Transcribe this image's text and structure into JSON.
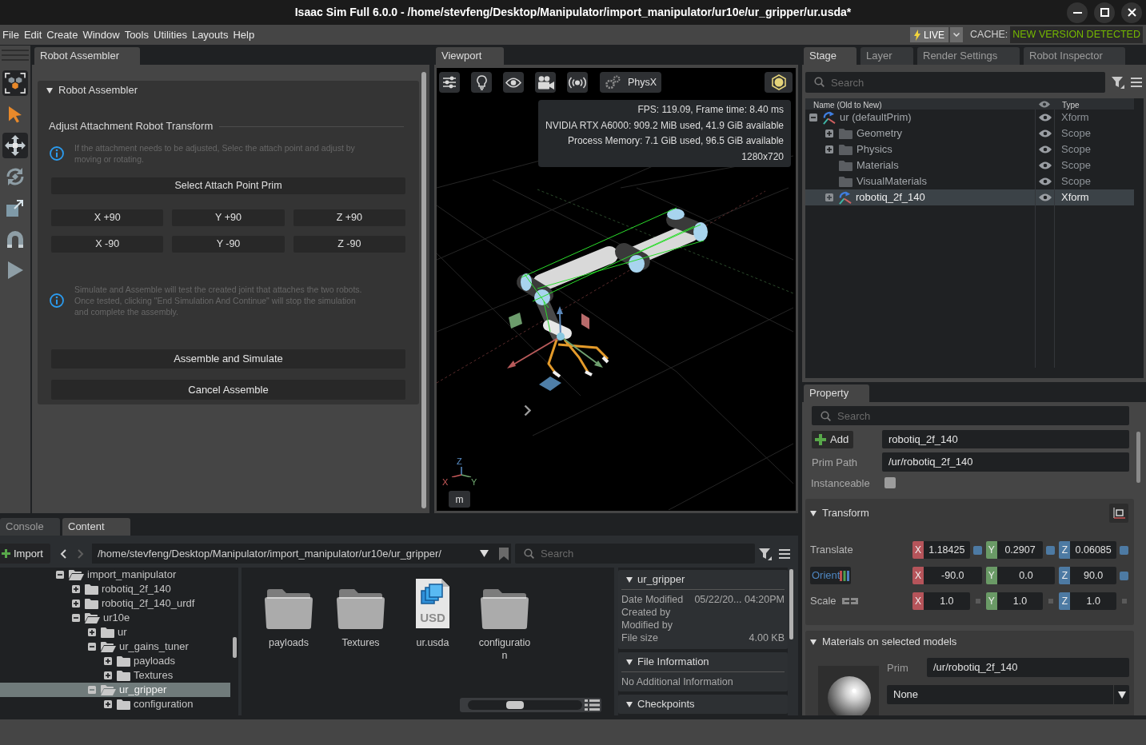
{
  "window": {
    "title": "Isaac Sim Full 6.0.0 - /home/stevfeng/Desktop/Manipulator/import_manipulator/ur10e/ur_gripper/ur.usda*"
  },
  "menu": [
    "File",
    "Edit",
    "Create",
    "Window",
    "Tools",
    "Utilities",
    "Layouts",
    "Help"
  ],
  "live": {
    "label": "LIVE"
  },
  "cache": {
    "label": "CACHE:",
    "status": "NEW VERSION DETECTED"
  },
  "toolbar": [
    {
      "selected": true
    },
    {
      "selected": false
    },
    {
      "selected": true
    },
    {
      "selected": false
    },
    {
      "selected": false
    },
    {
      "selected": false
    },
    {
      "selected": false
    }
  ],
  "robot_assembler": {
    "tab": {
      "label": "Robot Assembler",
      "selected": true
    },
    "frame": {
      "title": "Robot Assembler",
      "expanded": true
    },
    "adjust_heading": "Adjust Attachment Robot Transform",
    "adjust_note": "If the attachment needs to be adjusted, Selec the attach point and adjust by moving or rotating.",
    "select_button": "Select Attach Point Prim",
    "rotate_buttons": [
      "X +90",
      "Y +90",
      "Z +90",
      "X -90",
      "Y -90",
      "Z -90"
    ],
    "simulate_note": "Simulate and Assemble will test the created joint that attaches the two robots. Once tested, clicking \"End Simulation And Continue\" will stop the simulation and complete the assembly.",
    "action_buttons": [
      "Assemble and Simulate",
      "Cancel Assemble"
    ]
  },
  "viewport": {
    "tab": {
      "label": "Viewport",
      "selected": true
    },
    "physx_button": "PhysX",
    "stats": [
      "FPS: 119.09, Frame time: 8.40 ms",
      "NVIDIA RTX A6000: 909.2 MiB used, 41.9 GiB available",
      "Process Memory: 7.1 GiB used, 96.5 GiB available",
      "1280x720"
    ],
    "axis_labels": {
      "x": "X",
      "y": "Y",
      "z": "Z"
    },
    "unit_button": "m"
  },
  "stage": {
    "tabs": [
      {
        "label": "Stage",
        "selected": true
      },
      {
        "label": "Layer",
        "selected": false
      },
      {
        "label": "Render Settings",
        "selected": false
      },
      {
        "label": "Robot Inspector",
        "selected": false
      }
    ],
    "search": {
      "placeholder": "Search"
    },
    "columns": {
      "name": "Name (Old to New)",
      "type": "Type"
    },
    "tree": [
      {
        "name": "ur (defaultPrim)",
        "type": "Xform",
        "kind": "xform",
        "expanded": true,
        "selected": false,
        "visible": true,
        "children": [
          {
            "name": "Geometry",
            "type": "Scope",
            "kind": "scope",
            "expanded": false,
            "selected": false,
            "visible": true
          },
          {
            "name": "Physics",
            "type": "Scope",
            "kind": "scope",
            "expanded": false,
            "selected": false,
            "visible": true
          },
          {
            "name": "Materials",
            "type": "Scope",
            "kind": "scope",
            "selected": false,
            "visible": true
          },
          {
            "name": "VisualMaterials",
            "type": "Scope",
            "kind": "scope",
            "selected": false,
            "visible": true
          },
          {
            "name": "robotiq_2f_140",
            "type": "Xform",
            "kind": "xform",
            "expanded": false,
            "selected": true,
            "visible": true
          }
        ]
      }
    ]
  },
  "property": {
    "tab": {
      "label": "Property",
      "selected": true
    },
    "search": {
      "placeholder": "Search"
    },
    "add_button": "Add",
    "name_field": "robotiq_2f_140",
    "prim_path": {
      "label": "Prim Path",
      "value": "/ur/robotiq_2f_140"
    },
    "instanceable": {
      "label": "Instanceable",
      "checked": false
    },
    "transform": {
      "title": "Transform",
      "expanded": true,
      "rows": [
        {
          "kind": "translate",
          "label": "Translate",
          "components": [
            {
              "axis": "X",
              "value": "1.18425",
              "modified": true
            },
            {
              "axis": "Y",
              "value": "0.2907",
              "modified": true
            },
            {
              "axis": "Z",
              "value": "0.06085",
              "modified": true
            }
          ]
        },
        {
          "kind": "orient",
          "label": "Orient",
          "components": [
            {
              "axis": "X",
              "value": "-90.0",
              "modified": false
            },
            {
              "axis": "Y",
              "value": "0.0",
              "modified": false
            },
            {
              "axis": "Z",
              "value": "90.0",
              "modified": true
            }
          ]
        },
        {
          "kind": "scale",
          "label": "Scale",
          "components": [
            {
              "axis": "X",
              "value": "1.0",
              "modified": false
            },
            {
              "axis": "Y",
              "value": "1.0",
              "modified": false
            },
            {
              "axis": "Z",
              "value": "1.0",
              "modified": false
            }
          ]
        }
      ]
    },
    "materials": {
      "title": "Materials on selected models",
      "expanded": true,
      "prim_label": "Prim",
      "prim_value": "/ur/robotiq_2f_140",
      "material": "None"
    }
  },
  "bottom_tabs": [
    {
      "label": "Console",
      "selected": false
    },
    {
      "label": "Content",
      "selected": true
    }
  ],
  "content": {
    "import_button": "Import",
    "path": "/home/stevfeng/Desktop/Manipulator/import_manipulator/ur10e/ur_gripper/",
    "search": {
      "placeholder": "Search"
    },
    "tree": [
      {
        "name": "import_manipulator",
        "expanded": true,
        "selected": false,
        "children": [
          {
            "name": "robotiq_2f_140",
            "expanded": false,
            "selected": false
          },
          {
            "name": "robotiq_2f_140_urdf",
            "expanded": false,
            "selected": false
          },
          {
            "name": "ur10e",
            "expanded": true,
            "selected": false,
            "children": [
              {
                "name": "ur",
                "expanded": false,
                "selected": false
              },
              {
                "name": "ur_gains_tuner",
                "expanded": true,
                "selected": false,
                "children": [
                  {
                    "name": "payloads",
                    "expanded": false,
                    "selected": false
                  },
                  {
                    "name": "Textures",
                    "expanded": false,
                    "selected": false
                  }
                ]
              },
              {
                "name": "ur_gripper",
                "expanded": true,
                "selected": true,
                "children": [
                  {
                    "name": "configuration",
                    "expanded": false,
                    "selected": false
                  }
                ]
              }
            ]
          }
        ]
      }
    ],
    "items": [
      {
        "name": "payloads",
        "kind": "folder"
      },
      {
        "name": "Textures",
        "kind": "folder"
      },
      {
        "name": "ur.usda",
        "kind": "usd",
        "badge": "USD"
      },
      {
        "name": "configuration",
        "kind": "folder"
      }
    ],
    "thumbnail_size": {
      "level": 0.4
    },
    "details": {
      "title": "ur_gripper",
      "expanded": true,
      "fields": [
        {
          "label": "Date Modified",
          "value": "05/22/20... 04:20PM"
        },
        {
          "label": "Created by"
        },
        {
          "label": "Modified by"
        },
        {
          "label": "File size",
          "value": "4.00 KB"
        }
      ],
      "sections": [
        {
          "title": "File Information",
          "expanded": true,
          "text": "No Additional Information"
        },
        {
          "title": "Checkpoints",
          "expanded": true
        }
      ]
    }
  }
}
